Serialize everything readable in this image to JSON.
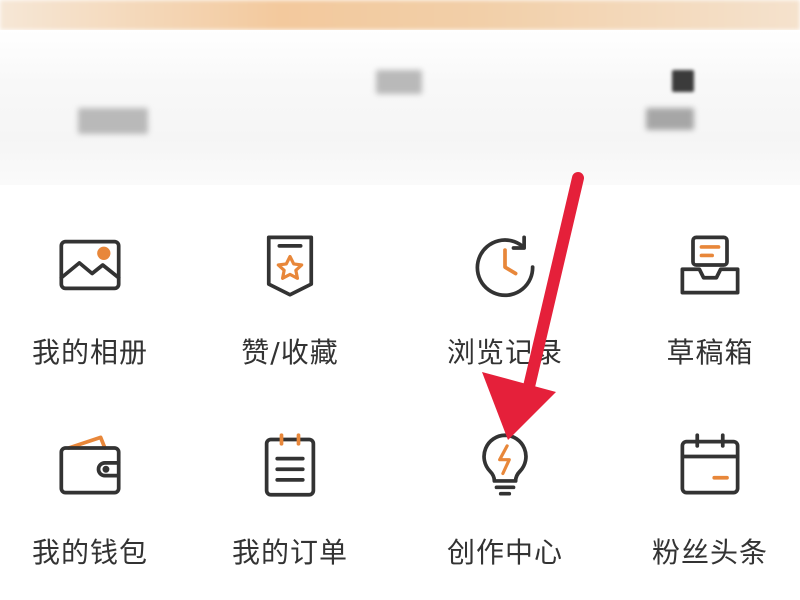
{
  "colors": {
    "accent": "#e8873a",
    "icon_stroke": "#333333",
    "label": "#333333",
    "annotation_arrow": "#e5203a"
  },
  "menu": {
    "items": [
      {
        "label": "我的相册",
        "icon": "photo-album-icon"
      },
      {
        "label": "赞/收藏",
        "icon": "favorites-badge-icon"
      },
      {
        "label": "浏览记录",
        "icon": "history-clock-icon"
      },
      {
        "label": "草稿箱",
        "icon": "drafts-inbox-icon"
      },
      {
        "label": "我的钱包",
        "icon": "wallet-icon"
      },
      {
        "label": "我的订单",
        "icon": "orders-clipboard-icon"
      },
      {
        "label": "创作中心",
        "icon": "creation-bulb-icon"
      },
      {
        "label": "粉丝头条",
        "icon": "calendar-icon"
      }
    ]
  }
}
